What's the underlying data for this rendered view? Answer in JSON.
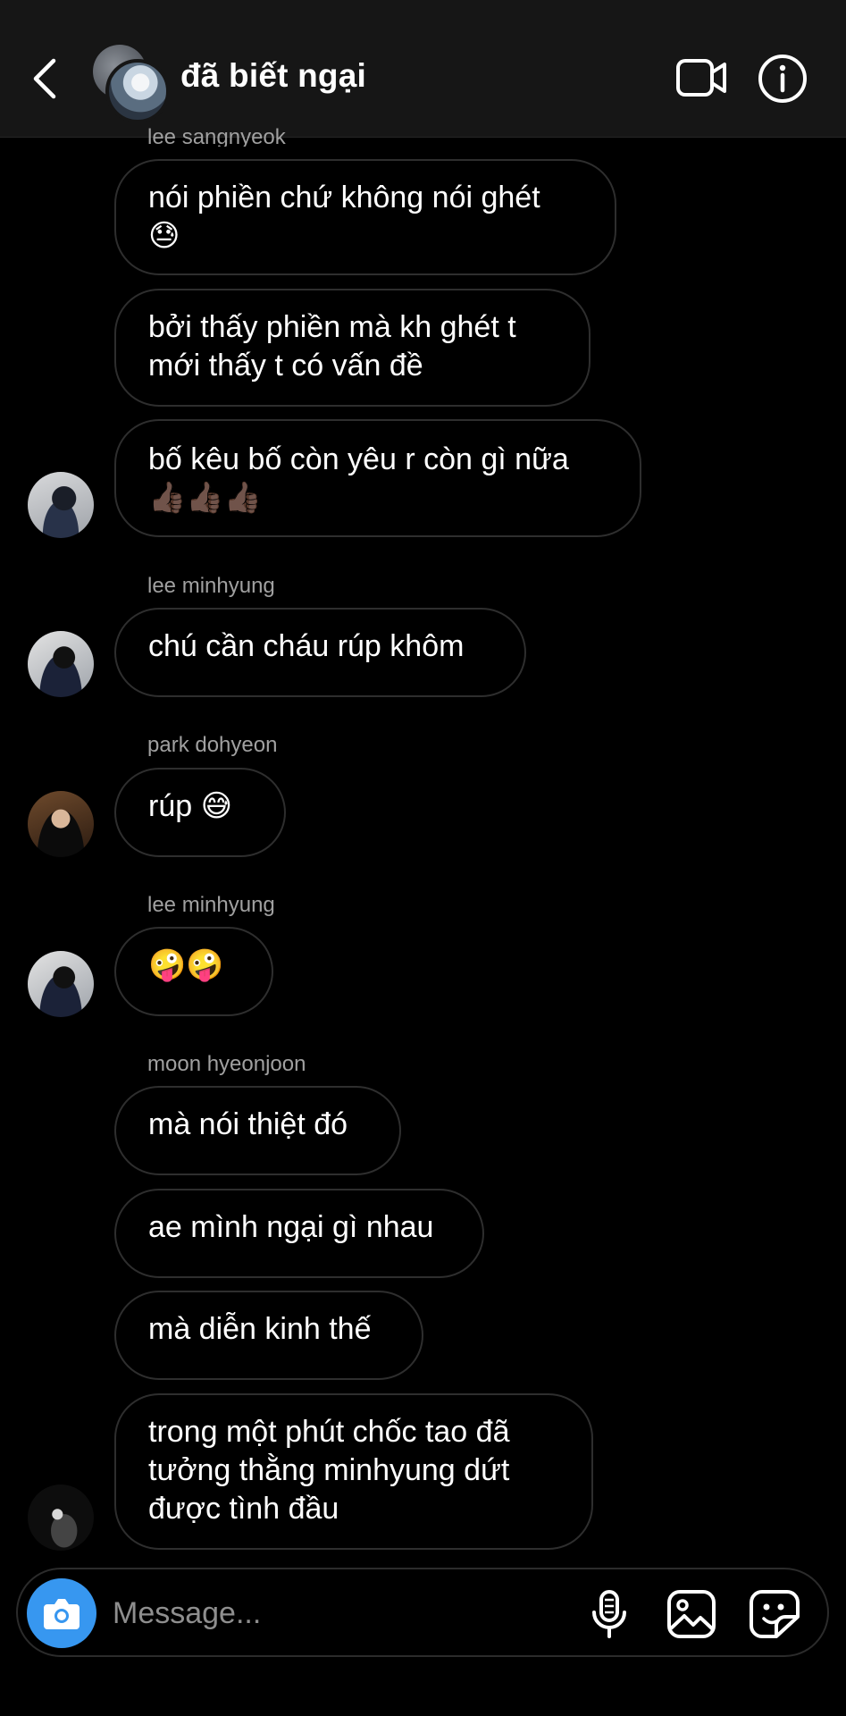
{
  "header": {
    "title": "đã biết ngại"
  },
  "messages": [
    {
      "sender": "lee sangnyeok",
      "text": "nói phiền chứ không nói ghét\n😓"
    },
    {
      "text": "bởi thấy phiền mà kh ghét t\nmới thấy t có vấn đề"
    },
    {
      "text": "bố kêu bố còn yêu r còn gì nữa\n👍🏿👍🏿👍🏿"
    },
    {
      "sender": "lee minhyung",
      "text": "chú cần cháu rúp khôm"
    },
    {
      "sender": "park dohyeon",
      "text": "rúp 😅"
    },
    {
      "sender": "lee minhyung",
      "text": "🤪🤪"
    },
    {
      "sender": "moon hyeonjoon",
      "text": "mà nói thiệt đó"
    },
    {
      "text": "ae mình ngại gì nhau"
    },
    {
      "text": "mà diễn kinh thế"
    },
    {
      "text": "trong một phút chốc tao đã\ntưởng thằng minhyung dứt\nđược tình đầu"
    }
  ],
  "composer": {
    "placeholder": "Message..."
  },
  "icons": {
    "back": "chevron-left-icon",
    "video": "video-call-icon",
    "info": "info-icon",
    "camera": "camera-icon",
    "mic": "microphone-icon",
    "gallery": "gallery-icon",
    "sticker": "sticker-icon"
  },
  "colors": {
    "background": "#000000",
    "header": "#161616",
    "bubble_border": "#2e2e2e",
    "accent": "#3797f0",
    "sender_text": "#a0a0a0"
  }
}
